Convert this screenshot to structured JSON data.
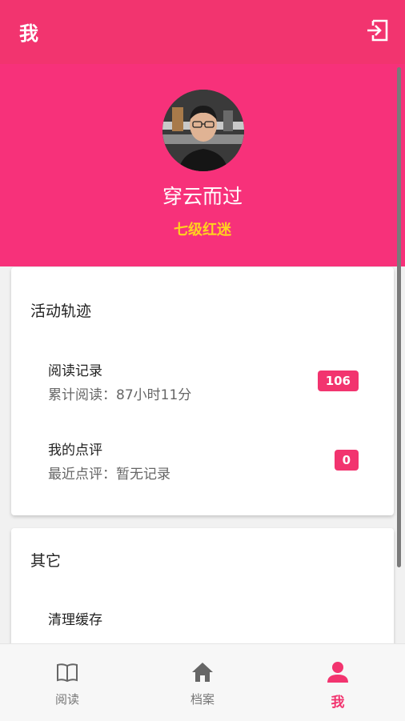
{
  "header": {
    "title": "我",
    "logout_icon": "logout-icon"
  },
  "profile": {
    "name": "穿云而过",
    "level": "七级红迷"
  },
  "activity": {
    "title": "活动轨迹",
    "items": [
      {
        "name": "阅读记录",
        "sub": "累计阅读：87小时11分",
        "badge": "106"
      },
      {
        "name": "我的点评",
        "sub": "最近点评：暂无记录",
        "badge": "0"
      }
    ]
  },
  "other": {
    "title": "其它",
    "items": [
      {
        "name": "清理缓存"
      }
    ]
  },
  "nav": {
    "tabs": [
      {
        "label": "阅读",
        "icon": "book-icon"
      },
      {
        "label": "档案",
        "icon": "home-icon"
      },
      {
        "label": "我",
        "icon": "person-icon"
      }
    ]
  },
  "colors": {
    "primary": "#f2346f",
    "level": "#ffd21f"
  }
}
